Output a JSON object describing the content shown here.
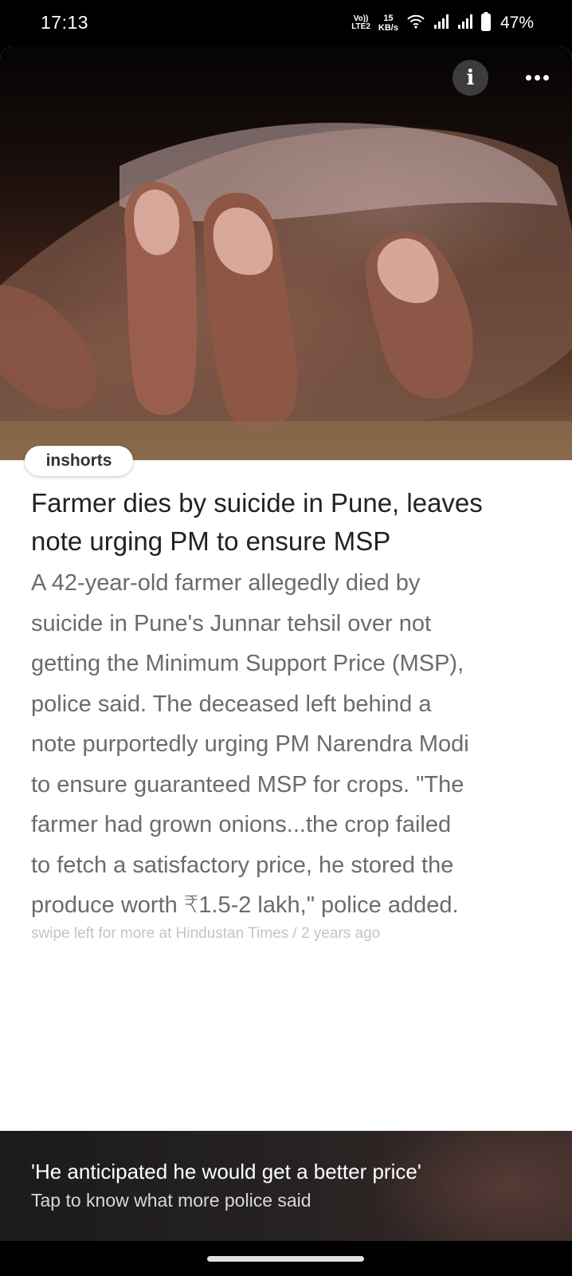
{
  "status_bar": {
    "time": "17:13",
    "volte_top": "Vo))",
    "volte_bottom": "LTE2",
    "speed_value": "15",
    "speed_unit": "KB/s",
    "battery": "47%",
    "icons": [
      "wifi-icon",
      "signal-icon",
      "signal-icon",
      "battery-icon"
    ]
  },
  "article": {
    "hero_image": "hand-photo",
    "info_icon": "i",
    "source_badge": "inshorts",
    "headline": "Farmer dies by suicide in Pune, leaves note urging PM to ensure MSP",
    "body_lines": [
      "A 42-year-old farmer allegedly died by",
      "suicide in Pune's Junnar tehsil over not",
      "getting the Minimum Support Price (MSP),",
      "police said. The deceased left behind a",
      "note purportedly urging PM Narendra Modi",
      "to ensure guaranteed MSP for crops. \"The",
      "farmer had grown onions...the crop failed",
      "to fetch a satisfactory price, he stored the",
      "produce worth ₹1.5-2 lakh,\" police added."
    ],
    "footer": "swipe left for more at Hindustan Times / 2 years ago"
  },
  "promo": {
    "title": "'He anticipated he would get a better price'",
    "subtitle": "Tap to know what more police said"
  }
}
